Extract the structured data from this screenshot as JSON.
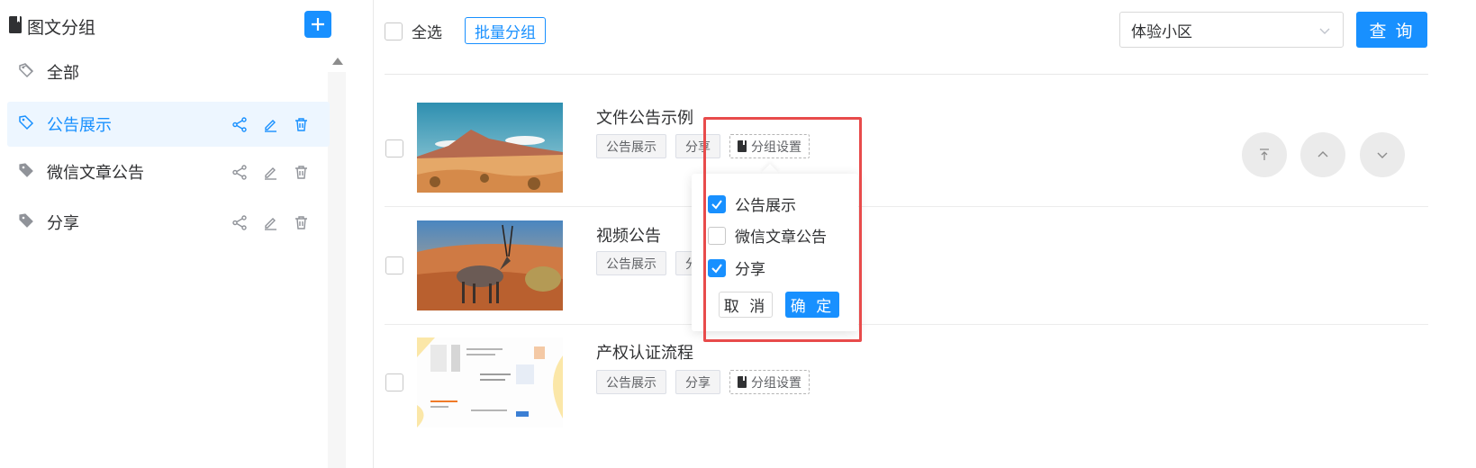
{
  "sidebar": {
    "title": "图文分组",
    "groups": [
      {
        "label": "全部"
      },
      {
        "label": "公告展示"
      },
      {
        "label": "微信文章公告"
      },
      {
        "label": "分享"
      }
    ]
  },
  "toolbar": {
    "select_all": "全选",
    "batch_group": "批量分组",
    "community": "体验小区",
    "query": "查 询"
  },
  "articles": [
    {
      "title": "文件公告示例",
      "tags": [
        "公告展示",
        "分享"
      ],
      "setting": "分组设置"
    },
    {
      "title": "视频公告",
      "tags": [
        "公告展示",
        "分"
      ],
      "setting": ""
    },
    {
      "title": "产权认证流程",
      "tags": [
        "公告展示",
        "分享"
      ],
      "setting": "分组设置"
    }
  ],
  "popover": {
    "options": [
      {
        "label": "公告展示",
        "checked": true
      },
      {
        "label": "微信文章公告",
        "checked": false
      },
      {
        "label": "分享",
        "checked": true
      }
    ],
    "cancel": "取 消",
    "confirm": "确 定"
  },
  "colors": {
    "primary": "#1890ff",
    "highlight": "#e84b4b"
  }
}
